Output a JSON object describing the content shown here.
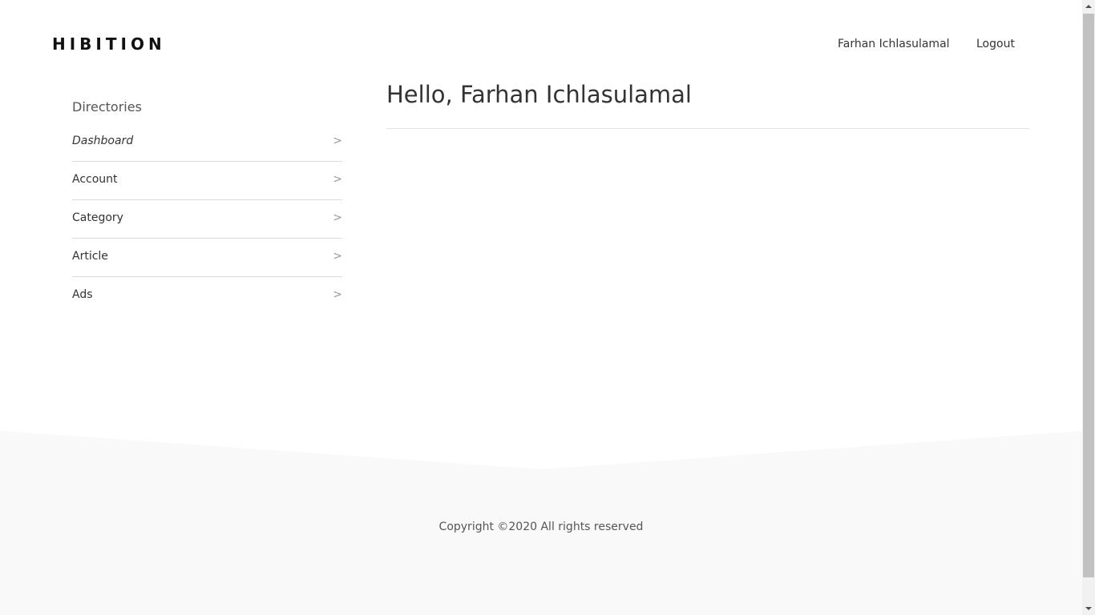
{
  "header": {
    "brand": "HIBITION",
    "nav": {
      "user": "Farhan Ichlasulamal",
      "logout": "Logout"
    }
  },
  "sidebar": {
    "title": "Directories",
    "chevron": ">",
    "items": [
      {
        "label": "Dashboard",
        "active": true
      },
      {
        "label": "Account",
        "active": false
      },
      {
        "label": "Category",
        "active": false
      },
      {
        "label": "Article",
        "active": false
      },
      {
        "label": "Ads",
        "active": false
      }
    ]
  },
  "main": {
    "greeting": "Hello, Farhan Ichlasulamal"
  },
  "footer": {
    "copyright": "Copyright ©2020 All rights reserved"
  },
  "colors": {
    "footer_background": "#f9f9f9",
    "page_background": "#ffffff"
  }
}
